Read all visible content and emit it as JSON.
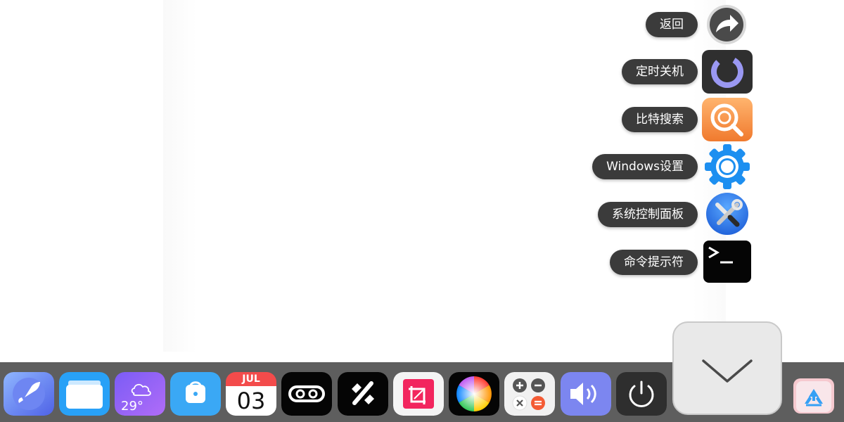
{
  "quick_menu": {
    "items": [
      {
        "label": "返回",
        "icon": "share-arrow-icon"
      },
      {
        "label": "定时关机",
        "icon": "timer-ring-icon"
      },
      {
        "label": "比特搜索",
        "icon": "search-magnifier-icon"
      },
      {
        "label": "Windows设置",
        "icon": "gear-icon"
      },
      {
        "label": "系统控制面板",
        "icon": "tools-icon"
      },
      {
        "label": "命令提示符",
        "icon": "terminal-icon"
      }
    ]
  },
  "dock": {
    "apps": [
      {
        "name": "launcher",
        "icon": "rocket-icon"
      },
      {
        "name": "files",
        "icon": "folder-icon"
      },
      {
        "name": "weather",
        "icon": "cloud-icon",
        "temp": "29°"
      },
      {
        "name": "store",
        "icon": "shopping-bag-icon"
      },
      {
        "name": "calendar",
        "icon": "calendar-icon",
        "month": "JUL",
        "day": "03"
      },
      {
        "name": "infinity",
        "icon": "infinity-icon"
      },
      {
        "name": "percent",
        "icon": "percent-icon"
      },
      {
        "name": "crop",
        "icon": "crop-icon"
      },
      {
        "name": "colors",
        "icon": "color-wheel-icon"
      },
      {
        "name": "calculator",
        "icon": "calculator-icon"
      },
      {
        "name": "volume",
        "icon": "speaker-icon"
      },
      {
        "name": "power",
        "icon": "power-icon"
      },
      {
        "name": "recycle",
        "icon": "recycle-bin-icon"
      }
    ]
  },
  "colors": {
    "dock_bg": "#5e5e5e",
    "pill_bg": "#3b3b3b",
    "expand_bg": "#e9e9e9"
  }
}
